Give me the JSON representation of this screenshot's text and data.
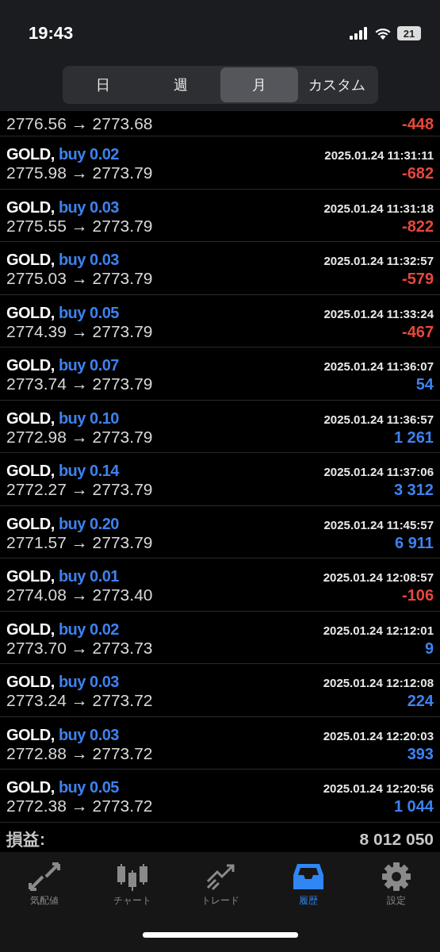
{
  "status_bar": {
    "time": "19:43",
    "battery": "21"
  },
  "tabs": [
    {
      "label": "日",
      "selected": false
    },
    {
      "label": "週",
      "selected": false
    },
    {
      "label": "月",
      "selected": true
    },
    {
      "label": "カスタム",
      "selected": false
    }
  ],
  "partial_row": {
    "prices": "2776.56 → 2773.68",
    "profit": "-448",
    "loss": true
  },
  "deals": [
    {
      "symbol": "GOLD,",
      "side": "buy 0.02",
      "time": "2025.01.24 11:31:11",
      "prices": "2775.98 → 2773.79",
      "profit": "-682",
      "loss": true
    },
    {
      "symbol": "GOLD,",
      "side": "buy 0.03",
      "time": "2025.01.24 11:31:18",
      "prices": "2775.55 → 2773.79",
      "profit": "-822",
      "loss": true
    },
    {
      "symbol": "GOLD,",
      "side": "buy 0.03",
      "time": "2025.01.24 11:32:57",
      "prices": "2775.03 → 2773.79",
      "profit": "-579",
      "loss": true
    },
    {
      "symbol": "GOLD,",
      "side": "buy 0.05",
      "time": "2025.01.24 11:33:24",
      "prices": "2774.39 → 2773.79",
      "profit": "-467",
      "loss": true
    },
    {
      "symbol": "GOLD,",
      "side": "buy 0.07",
      "time": "2025.01.24 11:36:07",
      "prices": "2773.74 → 2773.79",
      "profit": "54",
      "loss": false
    },
    {
      "symbol": "GOLD,",
      "side": "buy 0.10",
      "time": "2025.01.24 11:36:57",
      "prices": "2772.98 → 2773.79",
      "profit": "1 261",
      "loss": false
    },
    {
      "symbol": "GOLD,",
      "side": "buy 0.14",
      "time": "2025.01.24 11:37:06",
      "prices": "2772.27 → 2773.79",
      "profit": "3 312",
      "loss": false
    },
    {
      "symbol": "GOLD,",
      "side": "buy 0.20",
      "time": "2025.01.24 11:45:57",
      "prices": "2771.57 → 2773.79",
      "profit": "6 911",
      "loss": false
    },
    {
      "symbol": "GOLD,",
      "side": "buy 0.01",
      "time": "2025.01.24 12:08:57",
      "prices": "2774.08 → 2773.40",
      "profit": "-106",
      "loss": true
    },
    {
      "symbol": "GOLD,",
      "side": "buy 0.02",
      "time": "2025.01.24 12:12:01",
      "prices": "2773.70 → 2773.73",
      "profit": "9",
      "loss": false
    },
    {
      "symbol": "GOLD,",
      "side": "buy 0.03",
      "time": "2025.01.24 12:12:08",
      "prices": "2773.24 → 2773.72",
      "profit": "224",
      "loss": false
    },
    {
      "symbol": "GOLD,",
      "side": "buy 0.03",
      "time": "2025.01.24 12:20:03",
      "prices": "2772.88 → 2773.72",
      "profit": "393",
      "loss": false
    },
    {
      "symbol": "GOLD,",
      "side": "buy 0.05",
      "time": "2025.01.24 12:20:56",
      "prices": "2772.38 → 2773.72",
      "profit": "1 044",
      "loss": false
    }
  ],
  "summary": {
    "label": "損益:",
    "value": "8 012 050"
  },
  "nav": [
    {
      "label": "気配値",
      "kind": "quotes",
      "selected": false
    },
    {
      "label": "チャート",
      "kind": "chart",
      "selected": false
    },
    {
      "label": "トレード",
      "kind": "trade",
      "selected": false
    },
    {
      "label": "履歴",
      "kind": "history",
      "selected": true
    },
    {
      "label": "設定",
      "kind": "settings",
      "selected": false
    }
  ]
}
